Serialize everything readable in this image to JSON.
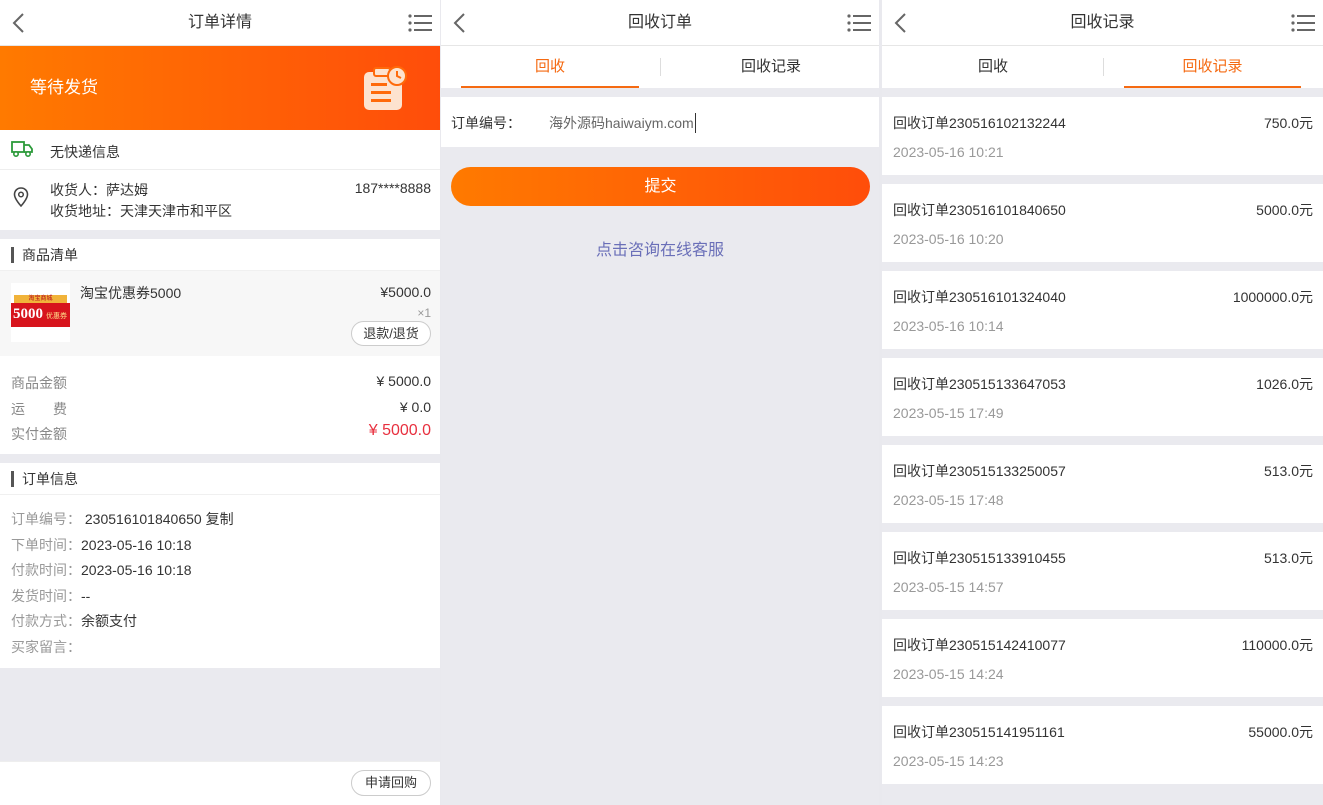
{
  "order_detail": {
    "title": "订单详情",
    "status": "等待发货",
    "shipping": "无快递信息",
    "receiver_label": "收货人：",
    "receiver_name": "萨达姆",
    "receiver_phone": "187****8888",
    "address_label": "收货地址：",
    "address": "天津天津市和平区",
    "goods_section": "商品清单",
    "product": {
      "name": "淘宝优惠券5000",
      "price": "¥5000.0",
      "qty": "×1",
      "refund_label": "退款/退货",
      "thumb_text": "5000",
      "thumb_small": "优惠券",
      "thumb_top": "淘宝商城"
    },
    "amounts": [
      {
        "label": "商品金额",
        "value": "¥ 5000.0"
      },
      {
        "label": "运　　费",
        "value": "¥ 0.0"
      },
      {
        "label": "实付金额",
        "value": "¥ 5000.0"
      }
    ],
    "info_section": "订单信息",
    "info": [
      {
        "label": "订单编号：",
        "value": "230516101840650",
        "extra": "复制"
      },
      {
        "label": "下单时间：",
        "value": "2023-05-16 10:18"
      },
      {
        "label": "付款时间：",
        "value": "2023-05-16 10:18"
      },
      {
        "label": "发货时间：",
        "value": "--"
      },
      {
        "label": "付款方式：",
        "value": "余额支付"
      },
      {
        "label": "买家留言：",
        "value": ""
      }
    ],
    "apply_button": "申请回购",
    "accent_red": "#e8303f"
  },
  "recycle_order": {
    "title": "回收订单",
    "tabs": [
      "回收",
      "回收记录"
    ],
    "order_label": "订单编号：",
    "order_value": "海外源码haiwaiym.com",
    "submit": "提交",
    "service_link": "点击咨询在线客服",
    "accent": "#f56a12",
    "link_color": "#6a6fb8"
  },
  "recycle_records": {
    "title": "回收记录",
    "tabs": [
      "回收",
      "回收记录"
    ],
    "records": [
      {
        "no": "回收订单230516102132244",
        "amount": "750.0元",
        "time": "2023-05-16 10:21"
      },
      {
        "no": "回收订单230516101840650",
        "amount": "5000.0元",
        "time": "2023-05-16 10:20"
      },
      {
        "no": "回收订单230516101324040",
        "amount": "1000000.0元",
        "time": "2023-05-16 10:14"
      },
      {
        "no": "回收订单230515133647053",
        "amount": "1026.0元",
        "time": "2023-05-15 17:49"
      },
      {
        "no": "回收订单230515133250057",
        "amount": "513.0元",
        "time": "2023-05-15 17:48"
      },
      {
        "no": "回收订单230515133910455",
        "amount": "513.0元",
        "time": "2023-05-15 14:57"
      },
      {
        "no": "回收订单230515142410077",
        "amount": "110000.0元",
        "time": "2023-05-15 14:24"
      },
      {
        "no": "回收订单230515141951161",
        "amount": "55000.0元",
        "time": "2023-05-15 14:23"
      }
    ]
  },
  "icons": [
    "back-chevron-icon",
    "menu-list-icon",
    "clipboard-clock-icon",
    "truck-icon",
    "location-pin-icon"
  ]
}
